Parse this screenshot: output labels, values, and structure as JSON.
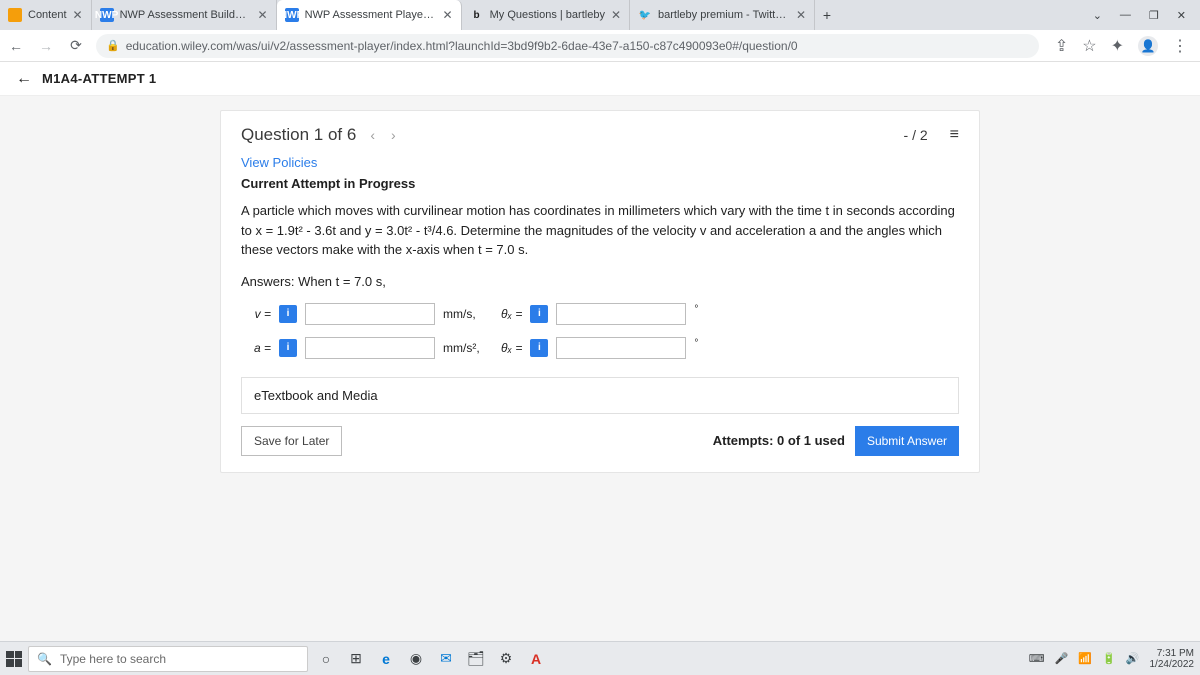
{
  "tabs": [
    {
      "label": "Content",
      "favicon": "orange",
      "closable": true
    },
    {
      "label": "NWP Assessment Builder UI Appl",
      "favicon": "nwp",
      "closable": true
    },
    {
      "label": "NWP Assessment Player UI Appli",
      "favicon": "nwp",
      "active": true,
      "closable": true
    },
    {
      "label": "My Questions | bartleby",
      "favicon": "b",
      "closable": true
    },
    {
      "label": "bartleby premium - Twitter Searc",
      "favicon": "twitter",
      "closable": true
    }
  ],
  "win": {
    "min": "—",
    "max": "❐",
    "close": "✕",
    "chev": "⌄"
  },
  "nav": {
    "back": "←",
    "fwd": "→",
    "reload": "⟳"
  },
  "url": {
    "lock": "🔒",
    "text": "education.wiley.com/was/ui/v2/assessment-player/index.html?launchId=3bd9f9b2-6dae-43e7-a150-c87c490093e0#/question/0"
  },
  "addr_icons": {
    "share": "⇪",
    "star": "☆",
    "ext": "✦",
    "menu": "⋮",
    "profile": "👤"
  },
  "app": {
    "back": "←",
    "title": "M1A4-ATTEMPT 1"
  },
  "question": {
    "title": "Question 1 of 6",
    "prev": "‹",
    "next": "›",
    "score": "- / 2",
    "list_icon": "≡",
    "view_policies": "View Policies",
    "attempt_label": "Current Attempt in Progress",
    "problem": "A particle which moves with curvilinear motion has coordinates in millimeters which vary with the time t in seconds according to x = 1.9t² - 3.6t and y = 3.0t² - t³/4.6. Determine the magnitudes of the velocity v and acceleration a and the angles which these vectors make with the x-axis when t = 7.0 s.",
    "answers_label": "Answers: When t = 7.0 s,",
    "rows": {
      "v": {
        "var": "v =",
        "unit": "mm/s,",
        "theta": "θₓ =",
        "deg": "°"
      },
      "a": {
        "var": "a =",
        "unit": "mm/s²,",
        "theta": "θₓ =",
        "deg": "°"
      }
    },
    "etextbook": "eTextbook and Media",
    "save": "Save for Later",
    "attempts": "Attempts: 0 of 1 used",
    "submit": "Submit Answer",
    "info": "i"
  },
  "taskbar": {
    "search_placeholder": "Type here to search",
    "search_icon": "🔍",
    "cortana": "○",
    "taskview": "⊞",
    "edge": "e",
    "chrome": "◉",
    "mail": "✉",
    "files": "🗂",
    "settings": "⚙",
    "a_icon": "A",
    "tray": {
      "kb": "⌨",
      "mic": "🎤",
      "wifi": "📶",
      "batt": "🔋",
      "vol": "🔊"
    },
    "time": "7:31 PM",
    "date": "1/24/2022"
  }
}
